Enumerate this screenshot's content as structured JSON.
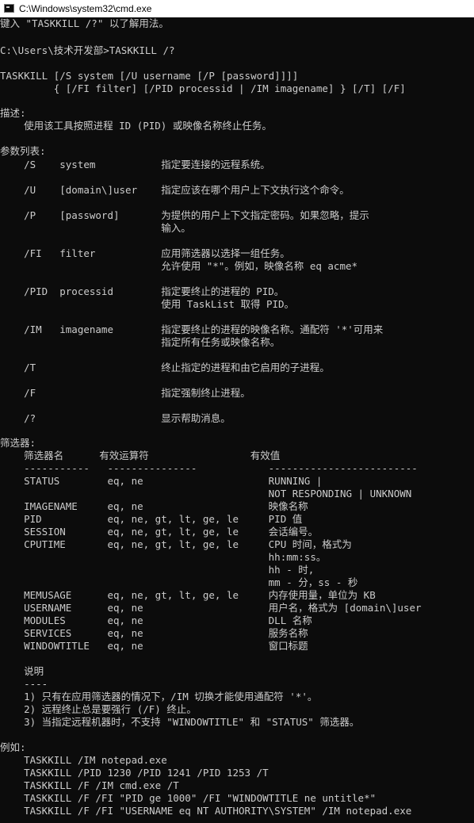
{
  "window": {
    "title": "C:\\Windows\\system32\\cmd.exe"
  },
  "console": {
    "lines": [
      "键入 \"TASKKILL /?\" 以了解用法。",
      "C:\\Users\\技术开发部>TASKKILL /?",
      "TASKKILL [/S system [/U username [/P [password]]]]",
      "         { [/FI filter] [/PID processid | /IM imagename] } [/T] [/F]",
      "描述:",
      "    使用该工具按照进程 ID (PID) 或映像名称终止任务。",
      "参数列表:",
      "    /S    system           指定要连接的远程系统。",
      "    /U    [domain\\]user    指定应该在哪个用户上下文执行这个命令。",
      "    /P    [password]       为提供的用户上下文指定密码。如果忽略，提示",
      "                           输入。",
      "    /FI   filter           应用筛选器以选择一组任务。",
      "                           允许使用 \"*\"。例如，映像名称 eq acme*",
      "    /PID  processid        指定要终止的进程的 PID。",
      "                           使用 TaskList 取得 PID。",
      "    /IM   imagename        指定要终止的进程的映像名称。通配符 '*'可用来",
      "                           指定所有任务或映像名称。",
      "    /T                     终止指定的进程和由它启用的子进程。",
      "    /F                     指定强制终止进程。",
      "    /?                     显示帮助消息。",
      "筛选器:",
      "    筛选器名      有效运算符                 有效值",
      "    -----------   ---------------            -------------------------",
      "    STATUS        eq, ne                     RUNNING |",
      "                                             NOT RESPONDING | UNKNOWN",
      "    IMAGENAME     eq, ne                     映像名称",
      "    PID           eq, ne, gt, lt, ge, le     PID 值",
      "    SESSION       eq, ne, gt, lt, ge, le     会话编号。",
      "    CPUTIME       eq, ne, gt, lt, ge, le     CPU 时间，格式为",
      "                                             hh:mm:ss。",
      "                                             hh - 时,",
      "                                             mm - 分，ss - 秒",
      "    MEMUSAGE      eq, ne, gt, lt, ge, le     内存使用量，单位为 KB",
      "    USERNAME      eq, ne                     用户名，格式为 [domain\\]user",
      "    MODULES       eq, ne                     DLL 名称",
      "    SERVICES      eq, ne                     服务名称",
      "    WINDOWTITLE   eq, ne                     窗口标题",
      "    说明",
      "    ----",
      "    1) 只有在应用筛选器的情况下，/IM 切换才能使用通配符 '*'。",
      "    2) 远程终止总是要强行 (/F) 终止。",
      "    3) 当指定远程机器时，不支持 \"WINDOWTITLE\" 和 \"STATUS\" 筛选器。",
      "例如:",
      "    TASKKILL /IM notepad.exe",
      "    TASKKILL /PID 1230 /PID 1241 /PID 1253 /T",
      "    TASKKILL /F /IM cmd.exe /T",
      "    TASKKILL /F /FI \"PID ge 1000\" /FI \"WINDOWTITLE ne untitle*\"",
      "    TASKKILL /F /FI \"USERNAME eq NT AUTHORITY\\SYSTEM\" /IM notepad.exe"
    ]
  }
}
